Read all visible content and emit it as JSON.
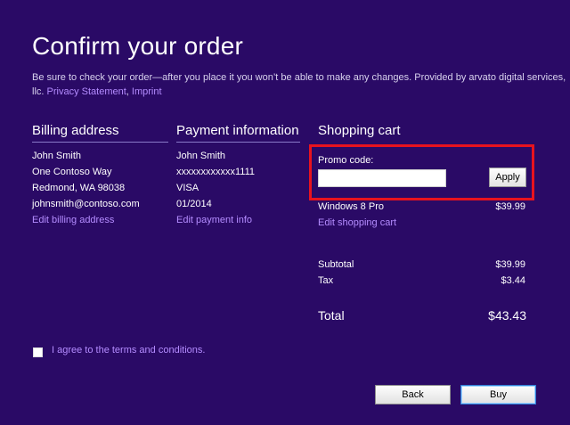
{
  "header": {
    "title": "Confirm your order",
    "subtitle": "Be sure to check your order—after you place it you won’t be able to make any changes. Provided by arvato digital services, llc.",
    "privacy_link": "Privacy Statement",
    "separator": ",",
    "imprint_link": "Imprint"
  },
  "billing": {
    "heading": "Billing address",
    "name": "John Smith",
    "street": "One Contoso Way",
    "city": "Redmond, WA 98038",
    "email": "johnsmith@contoso.com",
    "edit_link": "Edit billing address"
  },
  "payment": {
    "heading": "Payment information",
    "name": "John Smith",
    "card_number": "xxxxxxxxxxxx1111",
    "card_type": "VISA",
    "expiry": "01/2014",
    "edit_link": "Edit payment info"
  },
  "cart": {
    "heading": "Shopping cart",
    "promo_label": "Promo code:",
    "promo_value": "",
    "apply_label": "Apply",
    "item_name": "Windows 8 Pro",
    "item_price": "$39.99",
    "edit_link": "Edit shopping cart",
    "subtotal_label": "Subtotal",
    "subtotal_value": "$39.99",
    "tax_label": "Tax",
    "tax_value": "$3.44",
    "total_label": "Total",
    "total_value": "$43.43"
  },
  "terms": {
    "checked": false,
    "label": "I agree to the terms and conditions."
  },
  "footer": {
    "back_label": "Back",
    "buy_label": "Buy"
  },
  "colors": {
    "background": "#2a0a66",
    "link": "#b48cff",
    "highlight_border": "#e8131e"
  }
}
